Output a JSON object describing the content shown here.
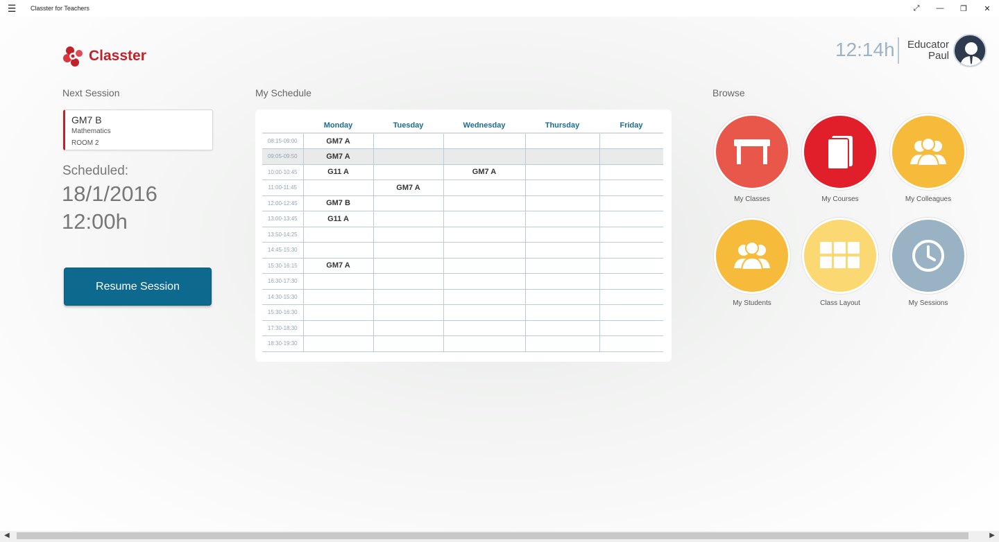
{
  "window": {
    "title": "Classter for Teachers",
    "menu_icon": "hamburger-icon",
    "controls": [
      "expand-icon",
      "minimize-icon",
      "restore-icon",
      "close-icon"
    ]
  },
  "logo": {
    "text": "Classter",
    "color": "#c0222b"
  },
  "header": {
    "clock": "12:14h",
    "user_role": "Educator",
    "user_name": "Paul"
  },
  "next_session": {
    "heading": "Next Session",
    "class_name": "GM7 B",
    "subject": "Mathematics",
    "room": "ROOM  2",
    "scheduled_label": "Scheduled:",
    "date": "18/1/2016",
    "time": "12:00h",
    "resume_label": "Resume Session"
  },
  "schedule": {
    "heading": "My Schedule",
    "days": [
      "Monday",
      "Tuesday",
      "Wednesday",
      "Thursday",
      "Friday"
    ],
    "rows": [
      {
        "time": "08:15-09:00",
        "cells": [
          "GM7 A",
          "",
          "",
          "",
          ""
        ]
      },
      {
        "time": "09:05-09:50",
        "cells": [
          "GM7 A",
          "",
          "",
          "",
          ""
        ]
      },
      {
        "time": "10:00-10:45",
        "cells": [
          "G11 A",
          "",
          "GM7 A",
          "",
          ""
        ]
      },
      {
        "time": "11:00-11:45",
        "cells": [
          "",
          "GM7 A",
          "",
          "",
          ""
        ]
      },
      {
        "time": "12:00-12:45",
        "cells": [
          "GM7 B",
          "",
          "",
          "",
          ""
        ]
      },
      {
        "time": "13:00-13:45",
        "cells": [
          "G11 A",
          "",
          "",
          "",
          ""
        ]
      },
      {
        "time": "13:50-14:25",
        "cells": [
          "",
          "",
          "",
          "",
          ""
        ]
      },
      {
        "time": "14:45-15:30",
        "cells": [
          "",
          "",
          "",
          "",
          ""
        ]
      },
      {
        "time": "15:30-16:15",
        "cells": [
          "GM7 A",
          "",
          "",
          "",
          ""
        ]
      },
      {
        "time": "16:30-17:30",
        "cells": [
          "",
          "",
          "",
          "",
          ""
        ]
      },
      {
        "time": "14:30-15:30",
        "cells": [
          "",
          "",
          "",
          "",
          ""
        ]
      },
      {
        "time": "15:30-16:30",
        "cells": [
          "",
          "",
          "",
          "",
          ""
        ]
      },
      {
        "time": "17:30-18:30",
        "cells": [
          "",
          "",
          "",
          "",
          ""
        ]
      },
      {
        "time": "18:30-19:30",
        "cells": [
          "",
          "",
          "",
          "",
          ""
        ]
      }
    ],
    "highlighted_row": "09:05-09:50"
  },
  "browse": {
    "heading": "Browse",
    "tiles": [
      {
        "label": "My Classes",
        "icon": "desk-icon",
        "color": "#e8574a"
      },
      {
        "label": "My Courses",
        "icon": "book-icon",
        "color": "#e01f2b"
      },
      {
        "label": "My Colleagues",
        "icon": "people-icon",
        "color": "#f7bb3c"
      },
      {
        "label": "My Students",
        "icon": "students-icon",
        "color": "#f7bb3c"
      },
      {
        "label": "Class Layout",
        "icon": "grid-icon",
        "color": "#fbd871"
      },
      {
        "label": "My Sessions",
        "icon": "clock-icon",
        "color": "#9ab3c4"
      }
    ]
  }
}
